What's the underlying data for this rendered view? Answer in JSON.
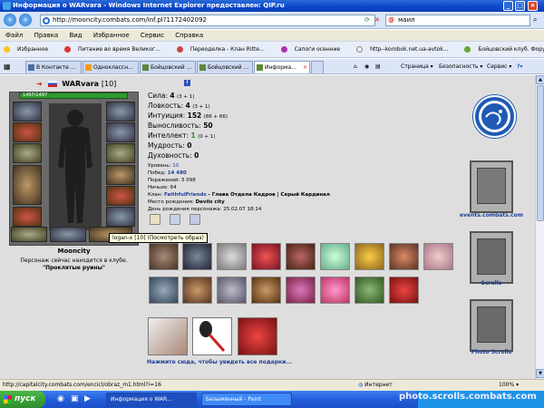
{
  "window": {
    "title": "Информация о WARvara - Windows Internet Explorer предоставлен: QIP.ru"
  },
  "address": {
    "url": "http://mooncity.combats.com/inf.pl?1172402092",
    "search_value": "маил"
  },
  "menu": [
    "Файл",
    "Правка",
    "Вид",
    "Избранное",
    "Сервис",
    "Справка"
  ],
  "favorites": {
    "label": "Избранное",
    "items": [
      "Питание во время Великог...",
      "Переоделка - Клан Ritte...",
      "Сапоги осенние",
      "http--korobok.net.ua-avtok...",
      "Бойцовский клуб. Форум П..."
    ]
  },
  "tabs": [
    "В Контакте ...",
    "Одноклассн...",
    "Бойцовский ...",
    "Бойцовский ...",
    "Информа..."
  ],
  "tab_tools": [
    "Страница",
    "Безопасность",
    "Сервис"
  ],
  "character": {
    "name": "WARvara",
    "level": "[10]",
    "hp": "1497/1497",
    "city": "Mooncity",
    "club_text": "Персонаж сейчас находится в клубе.",
    "club_name": "\"Проклятые руины\"",
    "tooltip": "logan-x [10] (Посмотреть образ)",
    "stats": [
      {
        "label": "Сила:",
        "value": "4",
        "extra": "(3 + 1)"
      },
      {
        "label": "Ловкость:",
        "value": "4",
        "extra": "(3 + 1)"
      },
      {
        "label": "Интуиция:",
        "value": "152",
        "extra": "(86 + 66)"
      },
      {
        "label": "Выносливость:",
        "value": "50",
        "extra": ""
      },
      {
        "label": "Интеллект:",
        "value": "1",
        "extra": "(0 + 1)"
      },
      {
        "label": "Мудрость:",
        "value": "0",
        "extra": ""
      },
      {
        "label": "Духовность:",
        "value": "0",
        "extra": ""
      }
    ],
    "info": {
      "level_label": "Уровень:",
      "level_value": "10",
      "wins_label": "Побед:",
      "wins_value": "14 480",
      "losses_label": "Поражений:",
      "losses_value": "5 098",
      "draws_label": "Ничьих:",
      "draws_value": "64",
      "clan_label": "Клан:",
      "clan_value": "FaithfulFriends",
      "clan_role": " - Глава Отдела Кадров | Серый Кардинал",
      "birthplace_label": "Место рождения:",
      "birthplace_value": "Devils city",
      "birthday_label": "День рождения персонажа:",
      "birthday_value": "25.02.07 18:14"
    }
  },
  "gift_link": "Нажмите сюда, чтобы увидеть все подарки...",
  "right_column": {
    "events_label": "events.combats.com",
    "scrolls_label": "Scrolls",
    "photo_label": "Photo Scrolls"
  },
  "status": {
    "url": "http://capitalcity.combats.com/encicl/obraz_m1.html?i=16",
    "zone": "Интернет",
    "zoom": "100%"
  },
  "taskbar": {
    "start": "пуск",
    "tasks": [
      "Информация о WAR...",
      "Безымянный - Paint"
    ],
    "watermark": "photo.scrolls.combats.com"
  }
}
